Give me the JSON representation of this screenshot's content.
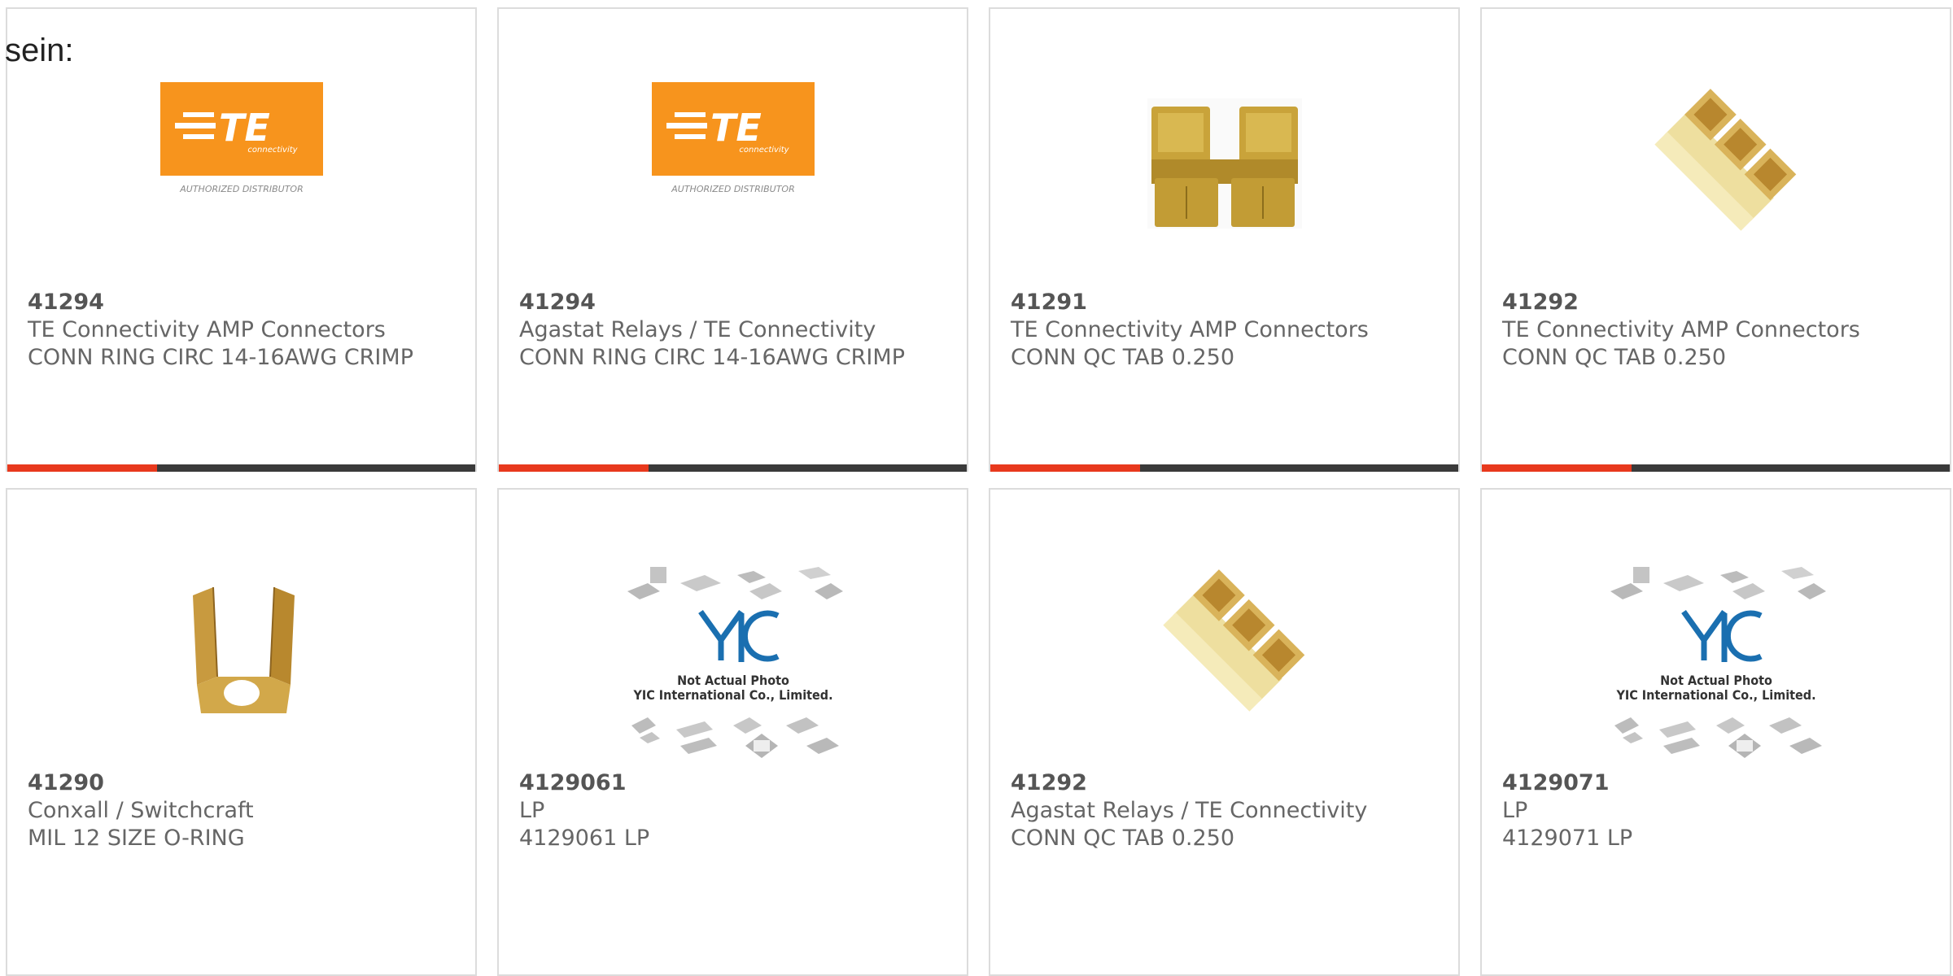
{
  "lead_text": "sein:",
  "accent_color": "#e8391d",
  "track_color": "#3a3a3a",
  "te_logo": {
    "mark": "TE",
    "word": "connectivity",
    "caption": "AUTHORIZED DISTRIBUTOR",
    "color": "#f7941d"
  },
  "yic_placeholder": {
    "mark": "YIC",
    "line1": "Not Actual Photo",
    "line2": "YIC International Co., Limited."
  },
  "cards": [
    {
      "part_number": "41294",
      "manufacturer": "TE Connectivity AMP Connectors",
      "description": "CONN RING CIRC 14-16AWG CRIMP",
      "image": "te-logo",
      "progress": 0.32
    },
    {
      "part_number": "41294",
      "manufacturer": "Agastat Relays / TE Connectivity",
      "description": "CONN RING CIRC 14-16AWG CRIMP",
      "image": "te-logo",
      "progress": 0.32
    },
    {
      "part_number": "41291",
      "manufacturer": "TE Connectivity AMP Connectors",
      "description": "CONN QC TAB 0.250",
      "image": "double-tab-photo",
      "progress": 0.32
    },
    {
      "part_number": "41292",
      "manufacturer": "TE Connectivity AMP Connectors",
      "description": "CONN QC TAB 0.250",
      "image": "strip-tab-photo",
      "progress": 0.32
    },
    {
      "part_number": "41290",
      "manufacturer": "Conxall / Switchcraft",
      "description": "MIL 12 SIZE O-RING",
      "image": "u-bracket-photo"
    },
    {
      "part_number": "4129061",
      "manufacturer": "LP",
      "description": "4129061 LP",
      "image": "yic-placeholder"
    },
    {
      "part_number": "41292",
      "manufacturer": "Agastat Relays / TE Connectivity",
      "description": "CONN QC TAB 0.250",
      "image": "strip-tab-photo"
    },
    {
      "part_number": "4129071",
      "manufacturer": "LP",
      "description": "4129071 LP",
      "image": "yic-placeholder"
    }
  ]
}
